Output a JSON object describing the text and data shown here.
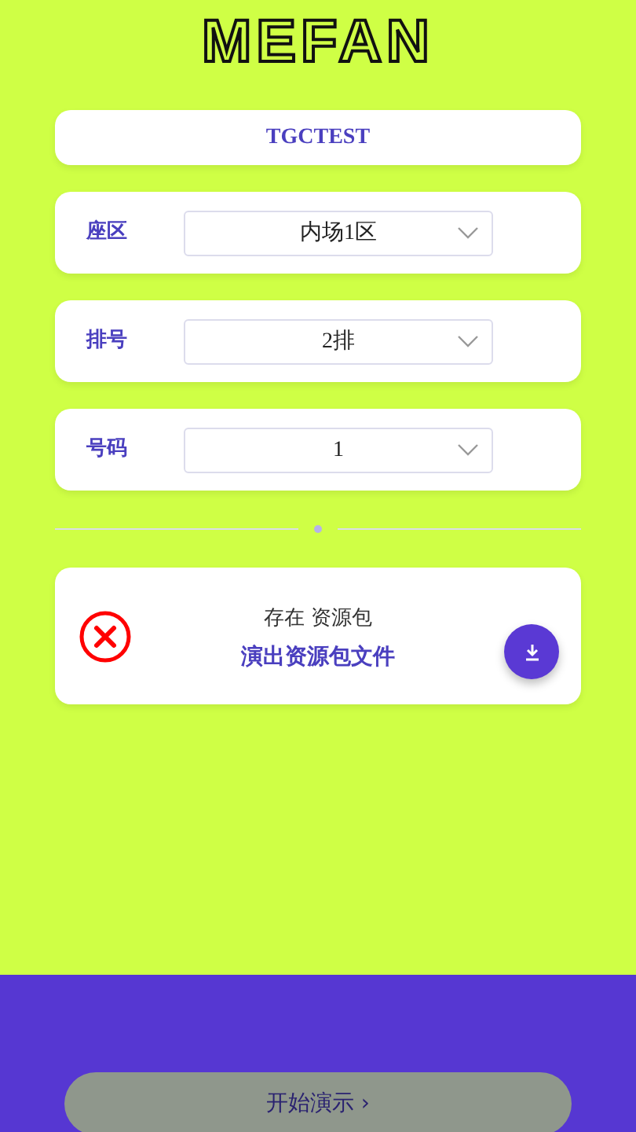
{
  "logo": {
    "text": "MEFAN"
  },
  "event": {
    "name": "TGCTEST"
  },
  "selectors": [
    {
      "label": "座区",
      "value": "内场1区"
    },
    {
      "label": "排号",
      "value": "2排"
    },
    {
      "label": "号码",
      "value": "1"
    }
  ],
  "resource": {
    "status_text": "存在 资源包",
    "title": "演出资源包文件",
    "available": false
  },
  "start_button": {
    "label": "开始演示",
    "arrow": "›",
    "disabled": true
  }
}
